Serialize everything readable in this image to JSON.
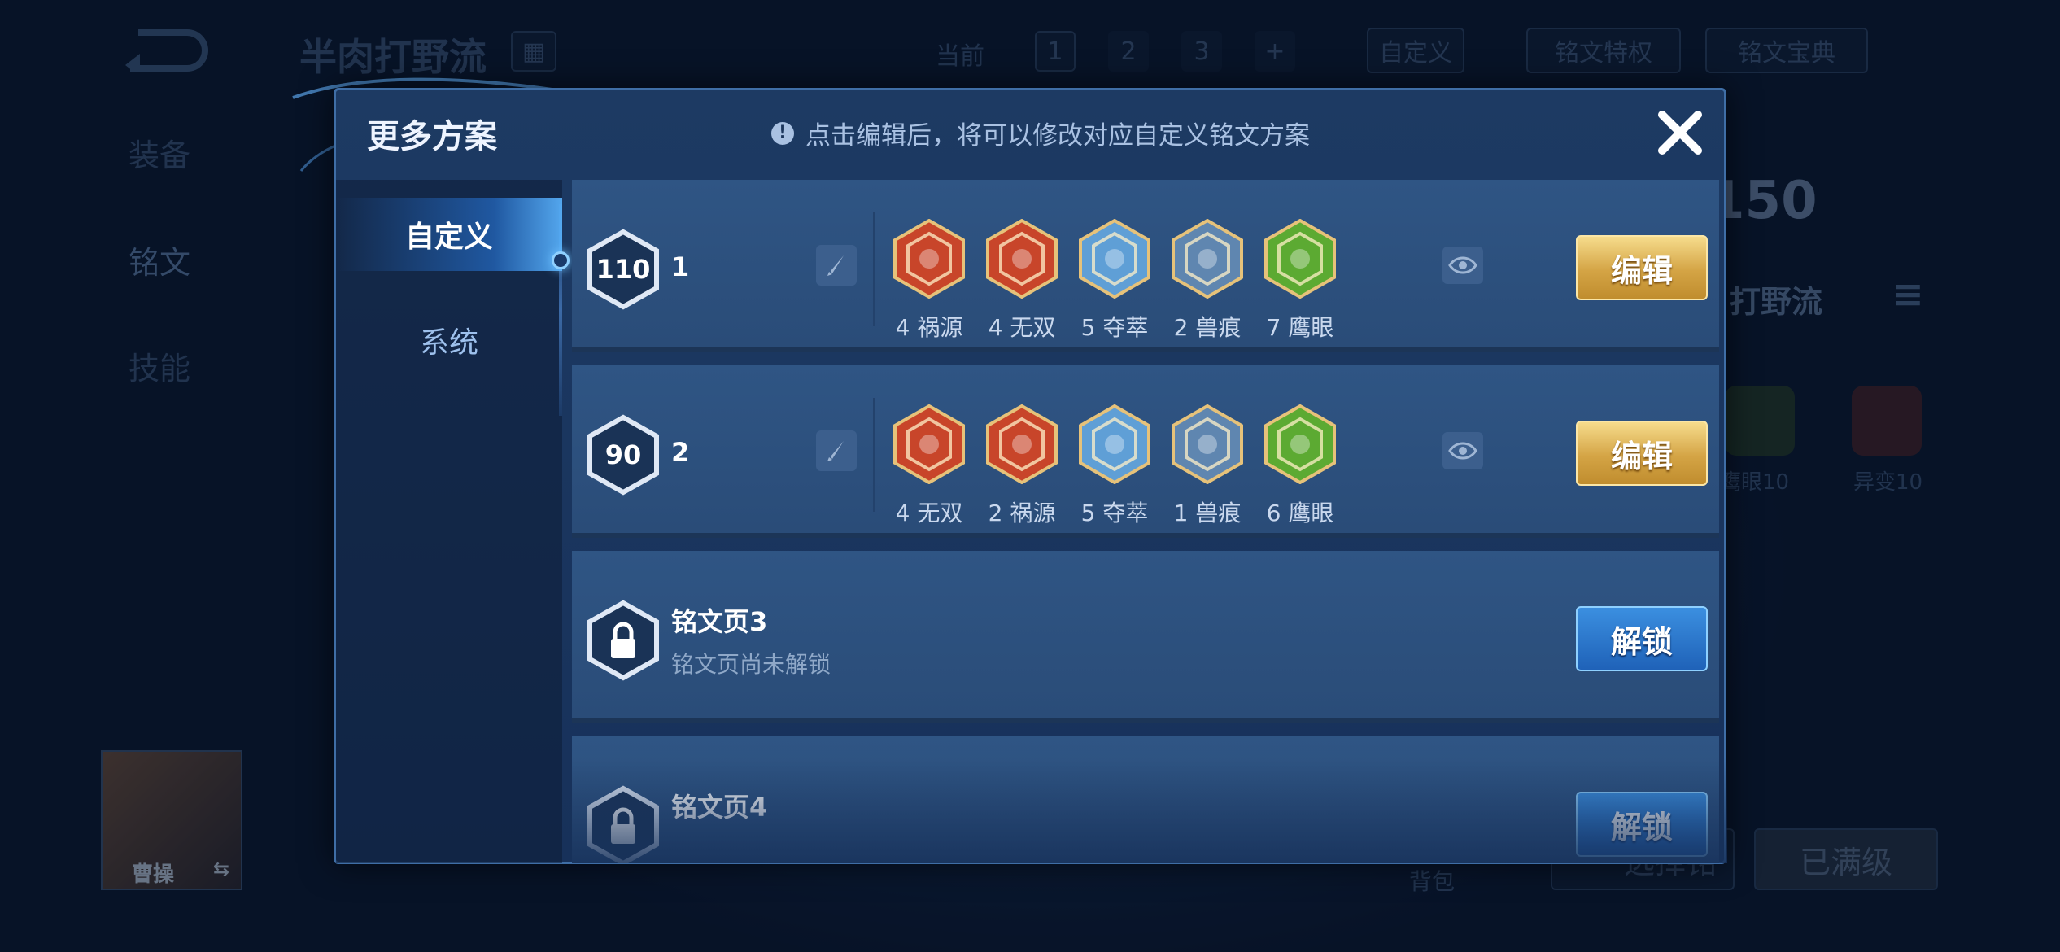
{
  "background": {
    "title": "半肉打野流",
    "tab_current": "当前",
    "page_tabs": [
      "1",
      "2",
      "3",
      "+"
    ],
    "custom": "自定义",
    "privilege": "铭文特权",
    "codex": "铭文宝典",
    "nav": [
      "装备",
      "铭文",
      "技能"
    ],
    "level": "150",
    "scheme_name": "打野流",
    "rune_a": "鹰眼10",
    "rune_b": "异变10",
    "hero": "曹操",
    "bag": "背包",
    "maxed": "已满级",
    "select": "选择铭"
  },
  "modal": {
    "title": "更多方案",
    "hint": "点击编辑后，将可以修改对应自定义铭文方案",
    "close_icon": "close-icon",
    "tabs": [
      "自定义",
      "系统"
    ]
  },
  "pages": [
    {
      "level": "110",
      "name": "1",
      "runes": [
        {
          "label": "4 祸源",
          "color": "#c8452a"
        },
        {
          "label": "4 无双",
          "color": "#c8452a"
        },
        {
          "label": "5 夺萃",
          "color": "#5f9fd6"
        },
        {
          "label": "2 兽痕",
          "color": "#5f86b0"
        },
        {
          "label": "7 鹰眼",
          "color": "#5caa32"
        }
      ],
      "button": "编辑"
    },
    {
      "level": "90",
      "name": "2",
      "runes": [
        {
          "label": "4 无双",
          "color": "#c8452a"
        },
        {
          "label": "2 祸源",
          "color": "#c8452a"
        },
        {
          "label": "5 夺萃",
          "color": "#5f9fd6"
        },
        {
          "label": "1 兽痕",
          "color": "#5f86b0"
        },
        {
          "label": "6 鹰眼",
          "color": "#5caa32"
        }
      ],
      "button": "编辑"
    },
    {
      "name": "铭文页3",
      "subtitle": "铭文页尚未解锁",
      "button": "解锁"
    },
    {
      "name": "铭文页4",
      "button": "解锁"
    }
  ]
}
